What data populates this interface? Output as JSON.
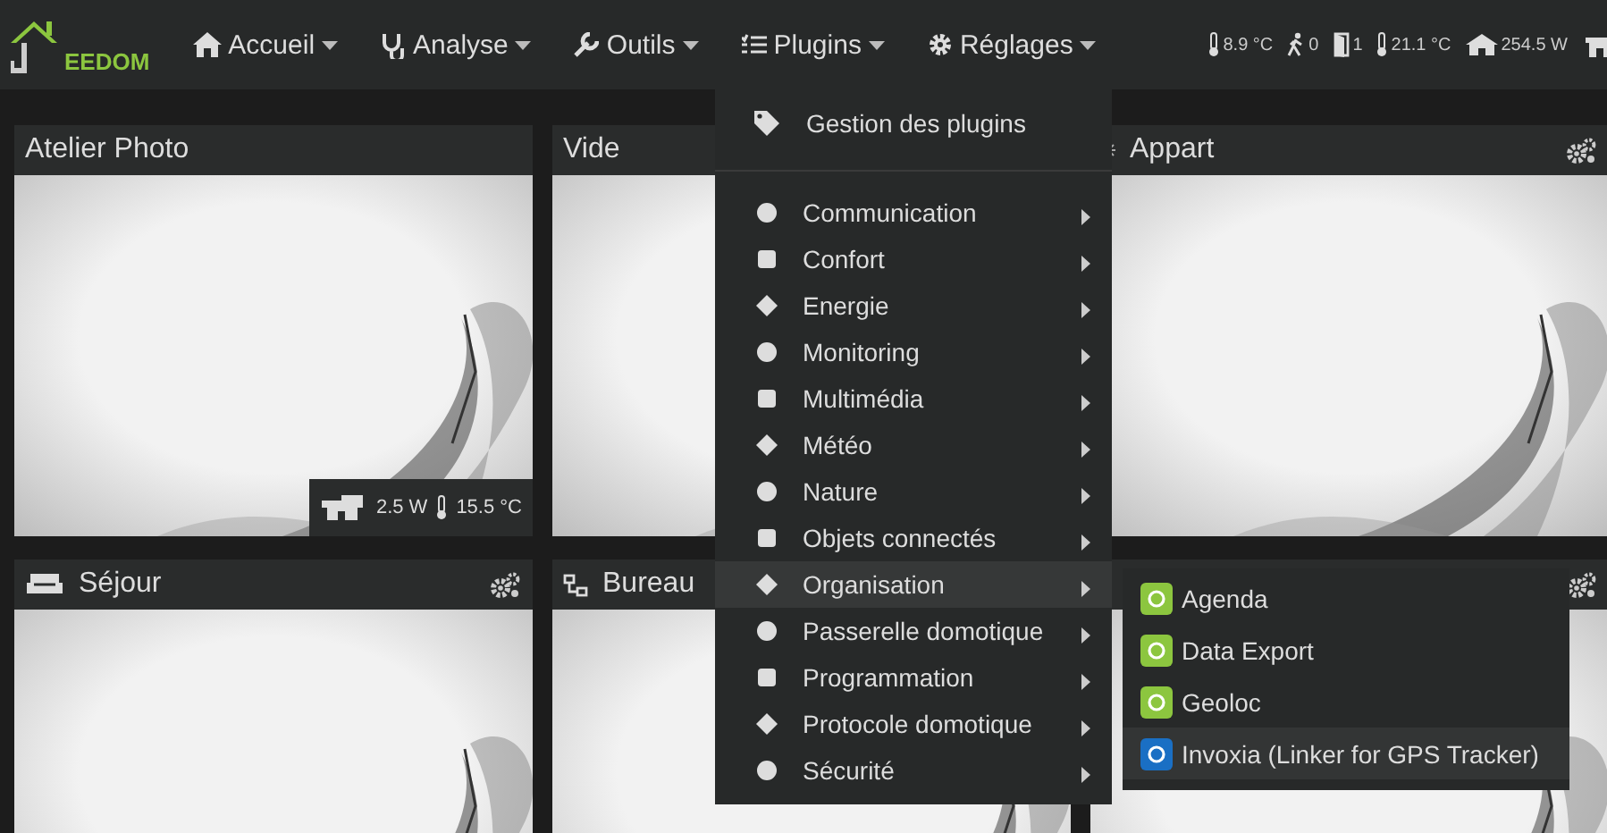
{
  "brand": "EEDOM",
  "nav": [
    {
      "label": "Accueil"
    },
    {
      "label": "Analyse"
    },
    {
      "label": "Outils"
    },
    {
      "label": "Plugins"
    },
    {
      "label": "Réglages"
    }
  ],
  "status": [
    {
      "value": "8.9 °C"
    },
    {
      "value": "0"
    },
    {
      "value": "1"
    },
    {
      "value": "21.1 °C"
    },
    {
      "value": "254.5 W"
    }
  ],
  "cards": [
    {
      "kind": "plain",
      "title": "Atelier Photo",
      "settings": false,
      "stats": [
        {
          "value": "2.5 W"
        },
        {
          "value": "15.5 °C"
        }
      ]
    },
    {
      "kind": "plain",
      "title": "Vide"
    },
    {
      "kind": "flat",
      "title": "Appart",
      "settings": true
    },
    {
      "kind": "sofa",
      "title": "Séjour",
      "settings": true
    },
    {
      "kind": "office",
      "title": "Bureau"
    },
    {
      "kind": "hidden",
      "settings": true
    }
  ],
  "plugins_menu": {
    "manage": "Gestion des plugins",
    "categories": [
      {
        "label": "Communication",
        "selected": false
      },
      {
        "label": "Confort",
        "selected": false
      },
      {
        "label": "Energie",
        "selected": false
      },
      {
        "label": "Monitoring",
        "selected": false
      },
      {
        "label": "Multimédia",
        "selected": false
      },
      {
        "label": "Météo",
        "selected": false
      },
      {
        "label": "Nature",
        "selected": false
      },
      {
        "label": "Objets connectés",
        "selected": false
      },
      {
        "label": "Organisation",
        "selected": true
      },
      {
        "label": "Passerelle domotique",
        "selected": false
      },
      {
        "label": "Programmation",
        "selected": false
      },
      {
        "label": "Protocole domotique",
        "selected": false
      },
      {
        "label": "Sécurité",
        "selected": false
      }
    ],
    "submenu": [
      {
        "label": "Agenda",
        "color": "#8cc63f",
        "selected": false
      },
      {
        "label": "Data Export",
        "color": "#8cc63f",
        "selected": false
      },
      {
        "label": "Geoloc",
        "color": "#8cc63f",
        "selected": false
      },
      {
        "label": "Invoxia (Linker for GPS Tracker)",
        "color": "#1a6fc4",
        "selected": true
      }
    ]
  }
}
